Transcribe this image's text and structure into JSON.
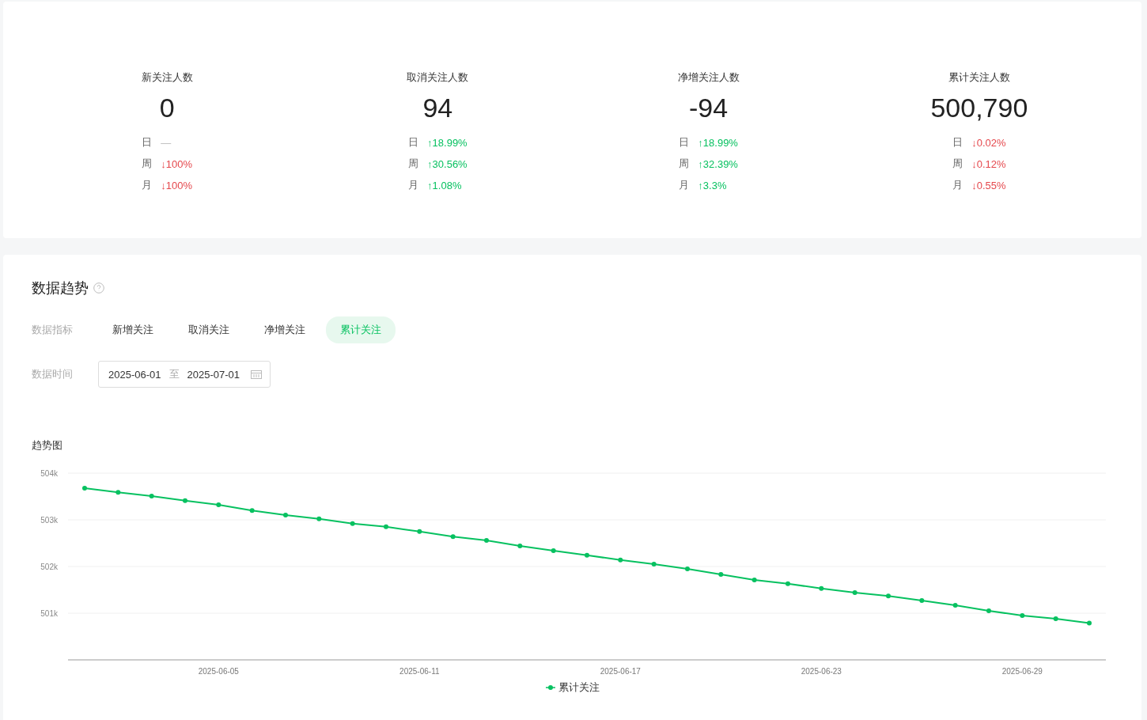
{
  "stats": [
    {
      "label": "新关注人数",
      "value": "0",
      "changes": [
        {
          "period": "日",
          "arrow": "—",
          "color": "#bbbbbb"
        },
        {
          "period": "周",
          "arrow": "↓",
          "value": "100%",
          "color": "#e5484d"
        },
        {
          "period": "月",
          "arrow": "↓",
          "value": "100%",
          "color": "#e5484d"
        }
      ]
    },
    {
      "label": "取消关注人数",
      "value": "94",
      "changes": [
        {
          "period": "日",
          "arrow": "↑",
          "value": "18.99%",
          "color": "#07c160"
        },
        {
          "period": "周",
          "arrow": "↑",
          "value": "30.56%",
          "color": "#07c160"
        },
        {
          "period": "月",
          "arrow": "↑",
          "value": "1.08%",
          "color": "#07c160"
        }
      ]
    },
    {
      "label": "净增关注人数",
      "value": "-94",
      "changes": [
        {
          "period": "日",
          "arrow": "↑",
          "value": "18.99%",
          "color": "#07c160"
        },
        {
          "period": "周",
          "arrow": "↑",
          "value": "32.39%",
          "color": "#07c160"
        },
        {
          "period": "月",
          "arrow": "↑",
          "value": "3.3%",
          "color": "#07c160"
        }
      ]
    },
    {
      "label": "累计关注人数",
      "value": "500,790",
      "changes": [
        {
          "period": "日",
          "arrow": "↓",
          "value": "0.02%",
          "color": "#e5484d"
        },
        {
          "period": "周",
          "arrow": "↓",
          "value": "0.12%",
          "color": "#e5484d"
        },
        {
          "period": "月",
          "arrow": "↓",
          "value": "0.55%",
          "color": "#e5484d"
        }
      ]
    }
  ],
  "trend": {
    "title": "数据趋势",
    "metric_label": "数据指标",
    "metrics": [
      {
        "label": "新增关注",
        "selected": false
      },
      {
        "label": "取消关注",
        "selected": false
      },
      {
        "label": "净增关注",
        "selected": false
      },
      {
        "label": "累计关注",
        "selected": true
      }
    ],
    "date_label": "数据时间",
    "date_range": {
      "start": "2025-06-01",
      "separator": "至",
      "end": "2025-07-01"
    },
    "chart_title": "趋势图",
    "chart_data": {
      "type": "line",
      "categories": [
        null,
        null,
        null,
        null,
        "2025-06-05",
        null,
        null,
        null,
        null,
        null,
        "2025-06-11",
        null,
        null,
        null,
        null,
        null,
        "2025-06-17",
        null,
        null,
        null,
        null,
        null,
        "2025-06-23",
        null,
        null,
        null,
        null,
        null,
        "2025-06-29",
        null,
        null
      ],
      "series": [
        {
          "name": "累计关注",
          "color": "#07c160",
          "marker": true,
          "values": [
            503680,
            503590,
            503510,
            503410,
            503320,
            503200,
            503100,
            503020,
            502920,
            502850,
            502750,
            502640,
            502560,
            502440,
            502340,
            502240,
            502140,
            502050,
            501950,
            501830,
            501710,
            501630,
            501530,
            501440,
            501370,
            501270,
            501170,
            501050,
            500950,
            500880,
            500790
          ]
        }
      ],
      "ylim": [
        500000,
        504000
      ],
      "yticks": [
        {
          "value": 501000,
          "label": "501k"
        },
        {
          "value": 502000,
          "label": "502k"
        },
        {
          "value": 503000,
          "label": "503k"
        },
        {
          "value": 504000,
          "label": "504k"
        }
      ],
      "grid": true
    }
  }
}
